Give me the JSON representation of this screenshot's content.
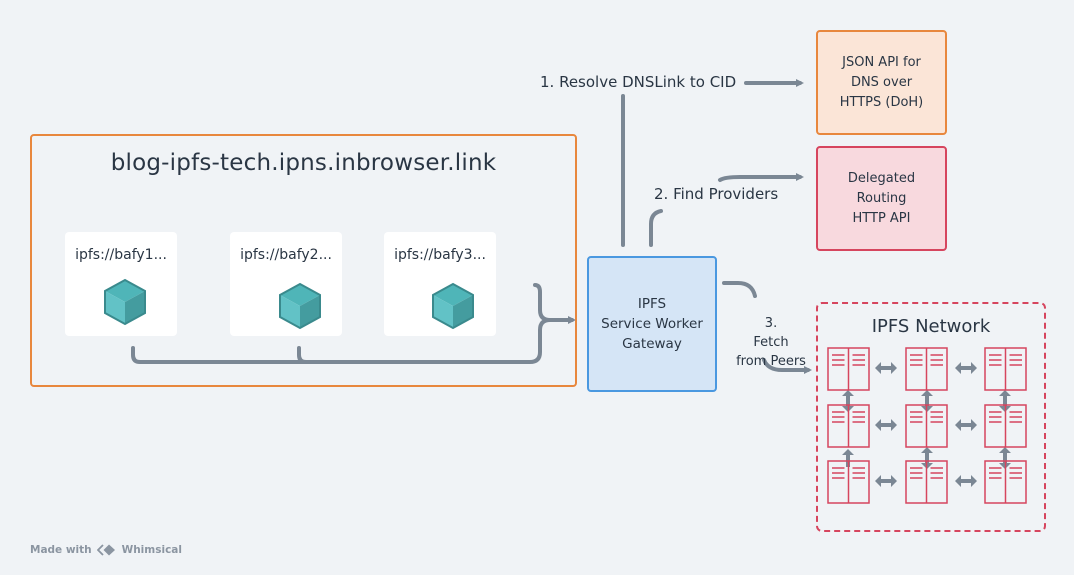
{
  "site": {
    "title": "blog-ipfs-tech.ipns.inbrowser.link",
    "cards": [
      {
        "label": "ipfs://bafy1...",
        "icon": "cube-icon"
      },
      {
        "label": "ipfs://bafy2...",
        "icon": "cube-icon"
      },
      {
        "label": "ipfs://bafy3...",
        "icon": "cube-icon"
      }
    ]
  },
  "gateway": {
    "lines": [
      "IPFS",
      "Service Worker",
      "Gateway"
    ]
  },
  "steps": {
    "resolve": "1.  Resolve DNSLink to CID",
    "providers": "2.  Find Providers",
    "fetch_lines": [
      "3.",
      "Fetch",
      "from Peers"
    ]
  },
  "doh_box": {
    "lines": [
      "JSON API for",
      "DNS over",
      "HTTPS (DoH)"
    ]
  },
  "delegated_box": {
    "lines": [
      "Delegated",
      "Routing",
      "HTTP API"
    ]
  },
  "network": {
    "title": "IPFS Network",
    "node_icon": "server-icon",
    "rows": 3,
    "cols": 3
  },
  "footer": {
    "made_with": "Made with",
    "brand": "Whimsical"
  },
  "colors": {
    "orange": "#e8873d",
    "blue": "#4a98e0",
    "red": "#d6455e",
    "arrow": "#7b8794",
    "cube": "#4fb5b8"
  }
}
